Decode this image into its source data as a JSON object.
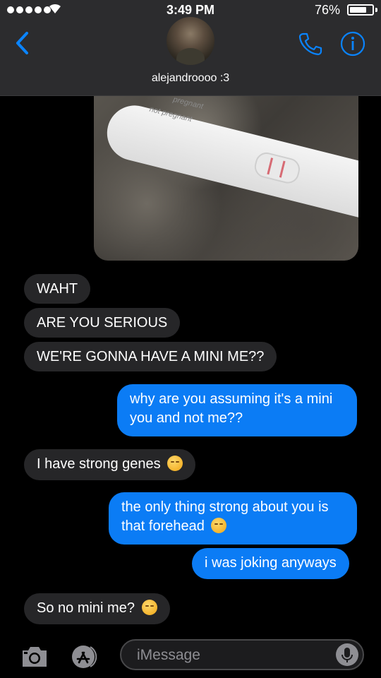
{
  "status_bar": {
    "time": "3:49 PM",
    "battery_percent": "76%",
    "battery_level": 0.76,
    "signal_bars": 5
  },
  "header": {
    "contact_name": "alejandroooo :3",
    "back_icon": "chevron-left-icon",
    "call_icon": "phone-icon",
    "info_icon": "info-icon"
  },
  "photo": {
    "test_text_1": "pregnant",
    "test_text_2": "not pregnant"
  },
  "messages": [
    {
      "direction": "in",
      "text": "WAHT"
    },
    {
      "direction": "in",
      "text": "ARE YOU SERIOUS"
    },
    {
      "direction": "in",
      "text": "WE'RE GONNA HAVE A MINI ME??"
    },
    {
      "direction": "out",
      "text_line1": "why are you assuming it's a mini",
      "text_line2": "you and not me??"
    },
    {
      "direction": "in",
      "text": "I have strong genes",
      "emoji": "relieved-face"
    },
    {
      "direction": "out",
      "text_line1": "the only thing strong about you is",
      "text_line2": "that forehead",
      "emoji": "unamused-face"
    },
    {
      "direction": "out",
      "text": "i was joking anyways"
    },
    {
      "direction": "in",
      "text": "So no mini me?",
      "emoji": "disappointed-face"
    }
  ],
  "input_bar": {
    "placeholder": "iMessage",
    "camera_icon": "camera-icon",
    "apps_icon": "app-store-icon",
    "mic_icon": "microphone-icon"
  },
  "colors": {
    "outgoing_bubble": "#0b7cf5",
    "incoming_bubble": "#262628",
    "accent": "#0a84ff",
    "header_bg": "#2c2c2e"
  }
}
